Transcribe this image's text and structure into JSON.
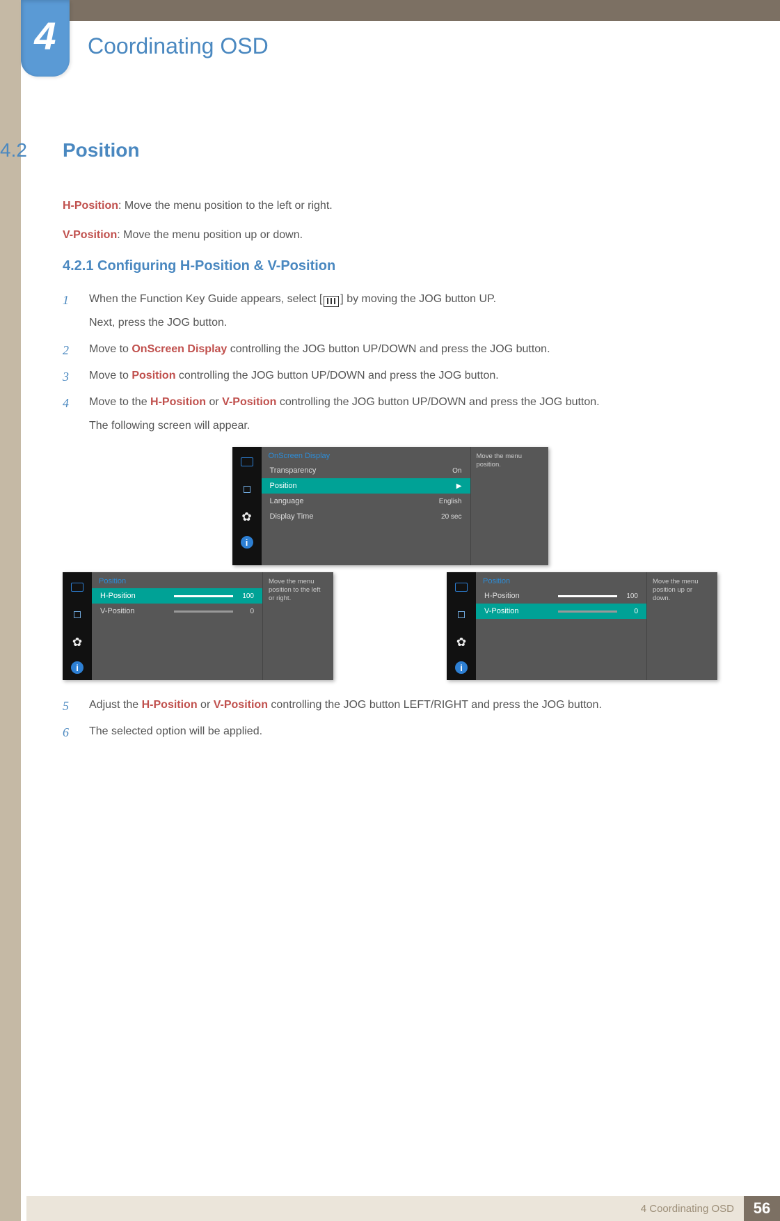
{
  "chapter": {
    "number": "4",
    "title": "Coordinating OSD"
  },
  "section": {
    "number": "4.2",
    "title": "Position",
    "h_desc_label": "H-Position",
    "h_desc_text": ": Move the menu position to the left or right.",
    "v_desc_label": "V-Position",
    "v_desc_text": ": Move the menu position up or down."
  },
  "subsection": {
    "number_title": "4.2.1    Configuring H-Position &  V-Position"
  },
  "steps": {
    "s1a": "When the Function Key Guide appears, select [",
    "s1b": "] by moving the JOG button UP.",
    "s1c": "Next, press the JOG button.",
    "s2a": "Move to ",
    "s2_red": "OnScreen Display",
    "s2b": " controlling the JOG button UP/DOWN and press the JOG button.",
    "s3a": "Move to ",
    "s3_red": "Position",
    "s3b": " controlling the JOG button UP/DOWN and press the JOG button.",
    "s4a": "Move to the ",
    "s4_red1": "H-Position",
    "s4_or": " or ",
    "s4_red2": "V-Position",
    "s4b": " controlling the JOG button UP/DOWN and press the JOG button.",
    "s4c": "The following screen will appear.",
    "s5a": "Adjust the ",
    "s5_red1": "H-Position",
    "s5_or": " or ",
    "s5_red2": "V-Position",
    "s5b": " controlling the JOG button LEFT/RIGHT and press the JOG button.",
    "s6": "The selected option will be applied."
  },
  "osd1": {
    "title": "OnScreen Display",
    "rows": {
      "transparency_l": "Transparency",
      "transparency_v": "On",
      "position_l": "Position",
      "language_l": "Language",
      "language_v": "English",
      "display_time_l": "Display Time",
      "display_time_v": "20 sec"
    },
    "tip": "Move the menu position."
  },
  "osd2": {
    "title": "Position",
    "hpos_l": "H-Position",
    "hpos_v": "100",
    "vpos_l": "V-Position",
    "vpos_v": "0",
    "tip": "Move the menu position to the left or right."
  },
  "osd3": {
    "title": "Position",
    "hpos_l": "H-Position",
    "hpos_v": "100",
    "vpos_l": "V-Position",
    "vpos_v": "0",
    "tip": "Move the menu position up or down."
  },
  "footer": {
    "label": "4 Coordinating OSD",
    "page": "56"
  }
}
